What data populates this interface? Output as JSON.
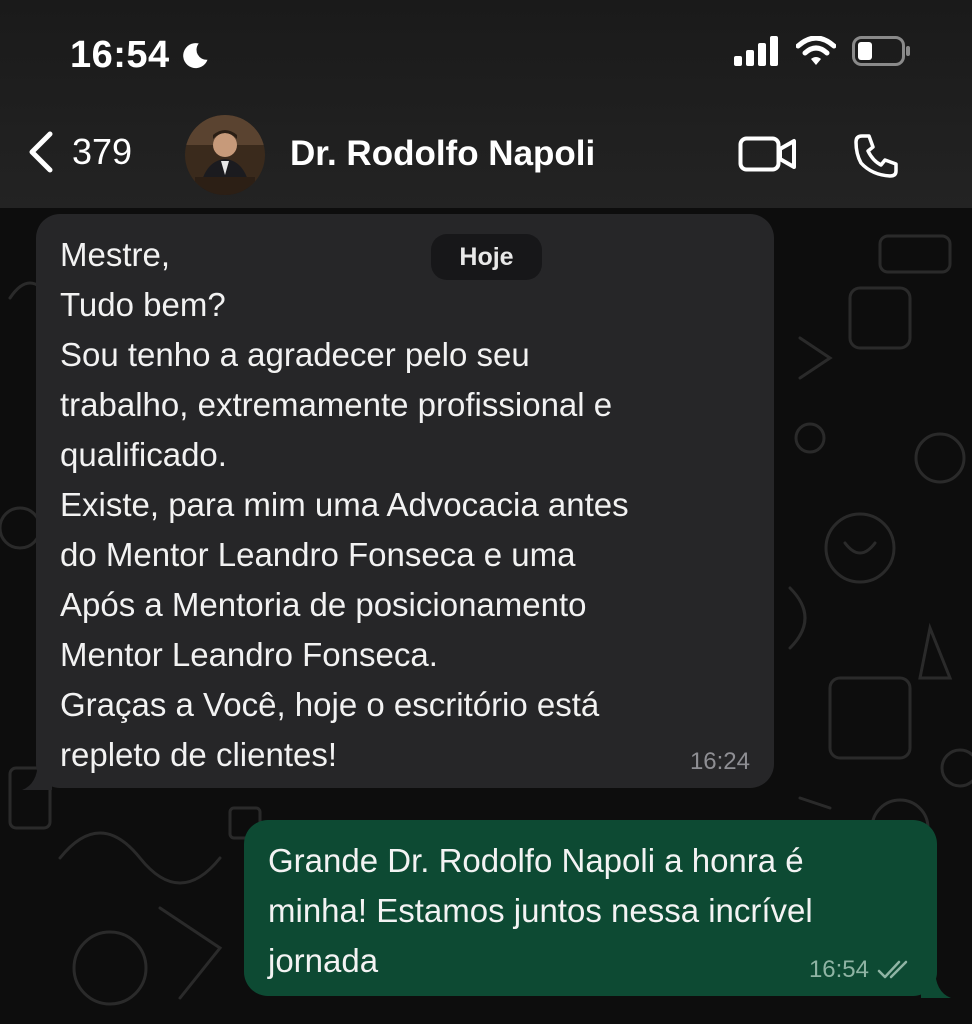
{
  "status_bar": {
    "time": "16:54",
    "icons": [
      "moon-icon",
      "cellular-signal-icon",
      "wifi-icon",
      "battery-icon"
    ]
  },
  "header": {
    "back_count": "379",
    "contact_name": "Dr. Rodolfo Napoli",
    "icons": [
      "chevron-left-icon",
      "video-call-icon",
      "phone-icon"
    ]
  },
  "date_separator": "Hoje",
  "messages": [
    {
      "direction": "incoming",
      "lines": [
        "Mestre,",
        "Tudo bem?",
        "Sou tenho a agradecer pelo seu",
        "trabalho, extremamente profissional e",
        "qualificado.",
        "Existe, para mim uma Advocacia antes",
        "do Mentor Leandro Fonseca e uma",
        "Após a Mentoria de posicionamento",
        "Mentor Leandro Fonseca.",
        "Graças a Você, hoje o escritório está",
        "repleto de clientes!"
      ],
      "time": "16:24"
    },
    {
      "direction": "outgoing",
      "lines": [
        "Grande Dr. Rodolfo Napoli a honra é",
        "minha! Estamos juntos nessa incrível",
        "jornada"
      ],
      "time": "16:54",
      "status_icon": "double-check-icon"
    }
  ],
  "colors": {
    "incoming_bubble": "#262628",
    "outgoing_bubble": "#0d4a33",
    "header_bg": "#1f1f1f",
    "chat_bg": "#0d0d0d"
  }
}
